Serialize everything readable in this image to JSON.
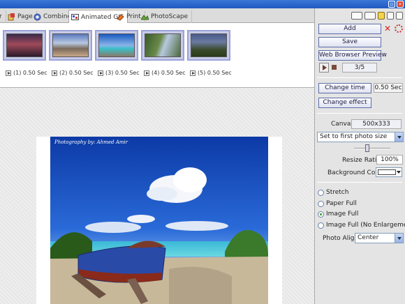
{
  "tabs": [
    {
      "label": "r",
      "icon": "tab-prev-icon"
    },
    {
      "label": "Page",
      "icon": "page-icon"
    },
    {
      "label": "Combine",
      "icon": "combine-icon"
    },
    {
      "label": "Animated GIF",
      "icon": "animated-gif-icon",
      "active": true
    },
    {
      "label": "Print",
      "icon": "print-icon"
    },
    {
      "label": "PhotoScape",
      "icon": "photoscape-icon"
    }
  ],
  "frames": [
    {
      "caption": "(1) 0.50 Sec",
      "theme": "sunset-icon"
    },
    {
      "caption": "(2) 0.50 Sec",
      "theme": "mountain-icon"
    },
    {
      "caption": "(3) 0.50 Sec",
      "theme": "beach-icon"
    },
    {
      "caption": "(4) 0.50 Sec",
      "theme": "river-icon"
    },
    {
      "caption": "(5) 0.50 Sec",
      "theme": "valley-icon"
    }
  ],
  "preview": {
    "credit": "Photography by: Ahmed Amir"
  },
  "panel": {
    "add": "Add",
    "save": "Save",
    "web_preview": "Web Browser Preview",
    "counter": "3/5",
    "change_time": "Change time",
    "time_value": "0.50 Sec",
    "change_effect": "Change effect",
    "canvas_label": "Canvas",
    "canvas_value": "500x333",
    "size_mode": "Set to first photo size",
    "resize_label": "Resize Ratio",
    "resize_value": "100%",
    "resize_level": 0.35,
    "bg_label": "Background Color",
    "bg_color": "#ffffff",
    "radios": [
      {
        "label": "Stretch",
        "checked": false
      },
      {
        "label": "Paper Full",
        "checked": false
      },
      {
        "label": "Image Full",
        "checked": true
      },
      {
        "label": "Image Full (No Enlargement)",
        "checked": false
      }
    ],
    "align_label": "Photo Align",
    "align_value": "Center"
  },
  "colors": {
    "accent": "#5c6ca8",
    "title_bar": "#2058c0",
    "thumb_border": "#9aa2d8"
  }
}
